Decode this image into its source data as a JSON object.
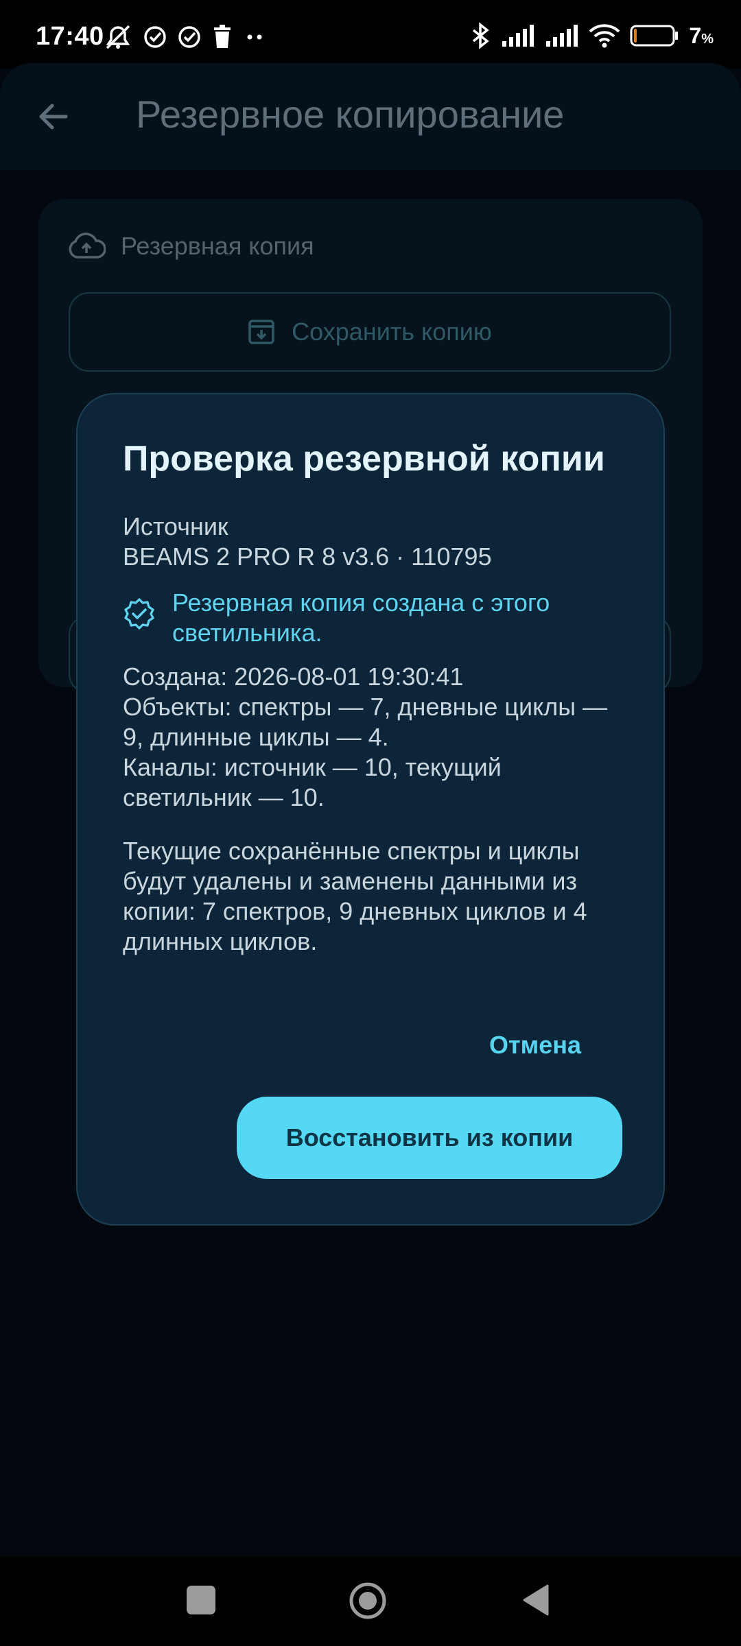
{
  "status_bar": {
    "time": "17:40",
    "battery_percent": "7",
    "battery_unit": "%",
    "left_icons": [
      "alarm-off-icon",
      "check-circle-icon",
      "check-circle-icon",
      "trash-icon",
      "more-dots-icon"
    ],
    "right_icons": [
      "bluetooth-icon",
      "signal-icon",
      "signal-icon",
      "wifi-icon",
      "battery-icon"
    ],
    "battery_level": 0.07
  },
  "app_bar": {
    "title": "Резервное копирование",
    "back_icon": "arrow-left-icon"
  },
  "backup_card": {
    "header_label": "Резервная копия",
    "header_icon": "cloud-upload-icon",
    "save_button_label": "Сохранить копию",
    "save_button_icon": "archive-download-icon"
  },
  "dialog": {
    "title": "Проверка резервной копии",
    "source_label": "Источник",
    "source_value": "BEAMS 2 PRO R 8 v3.6 · 110795",
    "verified_text": "Резервная копия создана с этого светильника.",
    "verified_icon": "verified-badge-icon",
    "info_text": "Создана: 2026-08-01 19:30:41\nОбъекты: спектры — 7, дневные циклы — 9, длинные циклы — 4.\nКаналы: источник — 10, текущий светильник — 10.",
    "warning_text": "Текущие сохранённые спектры и циклы будут удалены и заменены данными из копии: 7 спектров, 9 дневных циклов и 4 длинных циклов.",
    "cancel_label": "Отмена",
    "restore_label": "Восстановить из копии"
  },
  "colors": {
    "accent": "#54d8f4",
    "dialog_bg": "#0c2538",
    "verified_text": "#5fd3ef"
  },
  "nav_bar": {
    "icons": [
      "recents-square-icon",
      "home-circle-icon",
      "back-triangle-icon"
    ]
  }
}
